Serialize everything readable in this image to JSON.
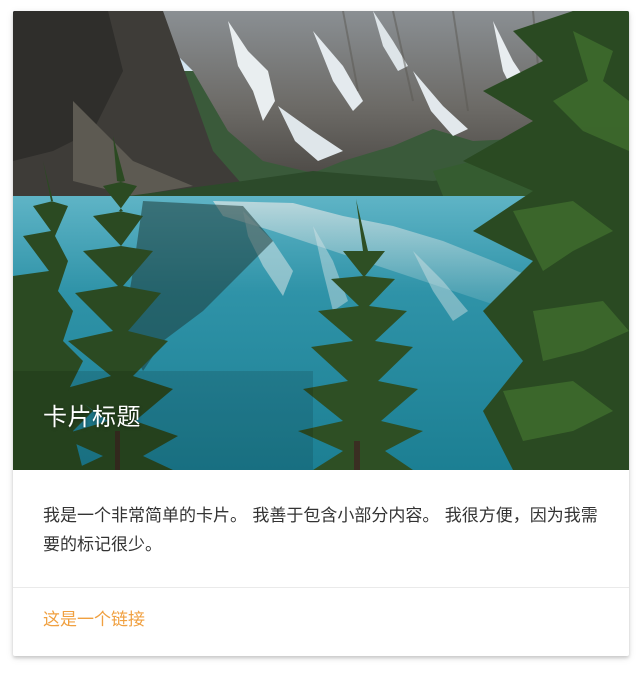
{
  "card": {
    "title": "卡片标题",
    "content": "我是一个非常简单的卡片。 我善于包含小部分内容。 我很方便，因为我需要的标记很少。",
    "link_label": "这是一个链接"
  },
  "colors": {
    "link": "#f0a040",
    "title": "#ffffff",
    "body_text": "#333333"
  },
  "image": {
    "subject": "mountain-lake-landscape"
  }
}
